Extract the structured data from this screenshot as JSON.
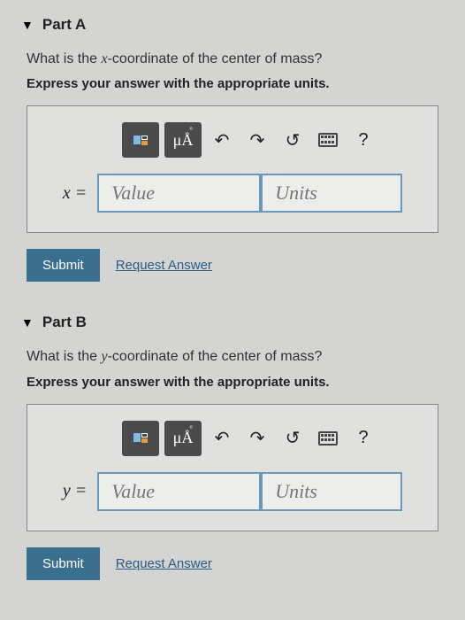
{
  "parts": [
    {
      "label": "Part A",
      "question_prefix": "What is the ",
      "question_var": "x",
      "question_suffix": "-coordinate of the center of mass?",
      "instruction": "Express your answer with the appropriate units.",
      "toolbar": {
        "units_btn": "μÅ"
      },
      "var_label": "x =",
      "value_placeholder": "Value",
      "units_placeholder": "Units",
      "submit": "Submit",
      "request": "Request Answer",
      "help": "?"
    },
    {
      "label": "Part B",
      "question_prefix": "What is the ",
      "question_var": "y",
      "question_suffix": "-coordinate of the center of mass?",
      "instruction": "Express your answer with the appropriate units.",
      "toolbar": {
        "units_btn": "μÅ"
      },
      "var_label": "y =",
      "value_placeholder": "Value",
      "units_placeholder": "Units",
      "submit": "Submit",
      "request": "Request Answer",
      "help": "?"
    }
  ]
}
